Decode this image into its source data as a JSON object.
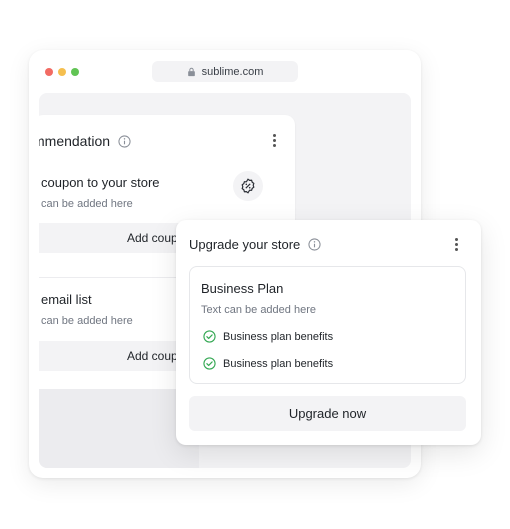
{
  "browser": {
    "url": "sublime.com",
    "traffic_lights": {
      "red": "#f26b63",
      "yellow": "#f5bf4f",
      "green": "#61c454"
    }
  },
  "recommendation_card": {
    "title": "mmendation",
    "items": [
      {
        "title": "coupon to your store",
        "subtitle": "can be added here",
        "button": "Add coupon",
        "icon": "discount-badge-icon"
      },
      {
        "title": "email list",
        "subtitle": "can be added here",
        "button": "Add coupon"
      }
    ]
  },
  "upgrade_card": {
    "title": "Upgrade your store",
    "plan": {
      "name": "Business Plan",
      "subtitle": "Text can be added here",
      "benefits": [
        "Business plan benefits",
        "Business plan benefits"
      ]
    },
    "button": "Upgrade now",
    "check_color": "#34a853"
  }
}
